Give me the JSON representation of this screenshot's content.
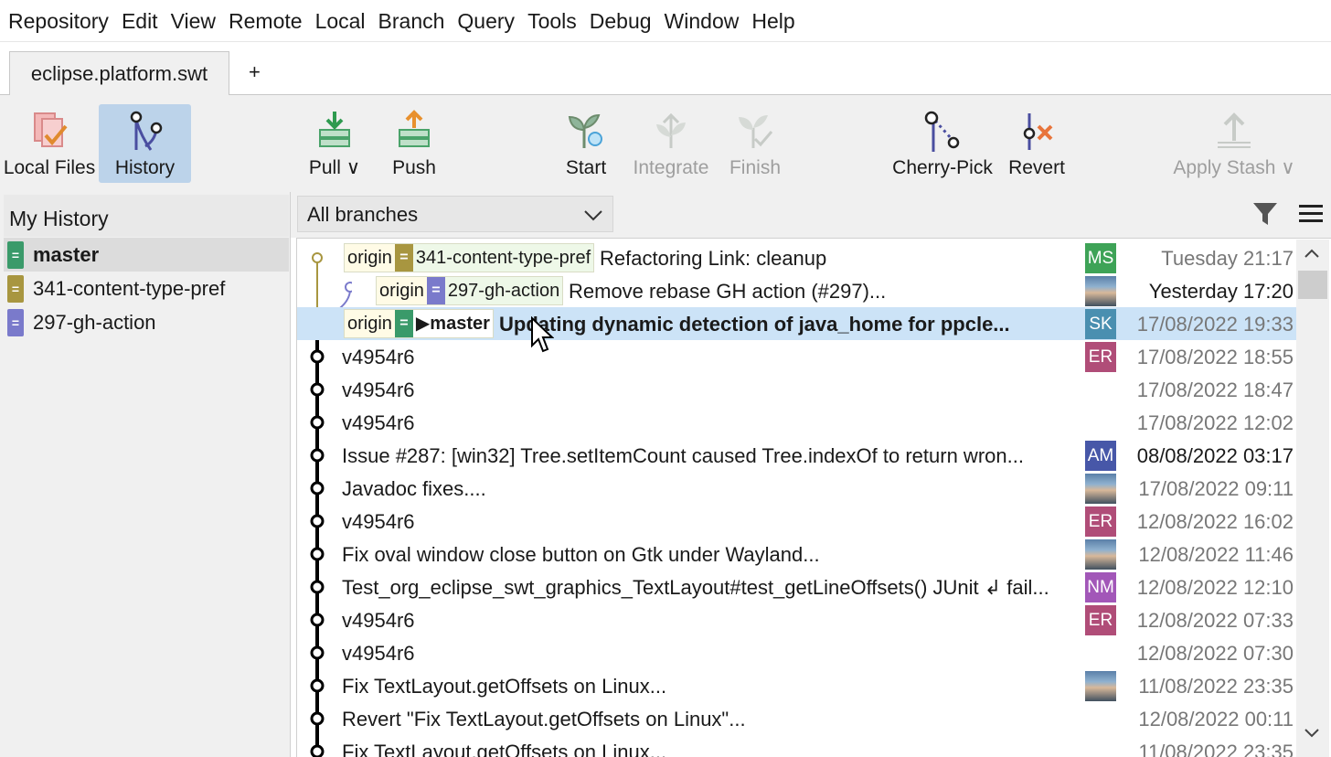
{
  "menu": [
    "Repository",
    "Edit",
    "View",
    "Remote",
    "Local",
    "Branch",
    "Query",
    "Tools",
    "Debug",
    "Window",
    "Help"
  ],
  "tabs": {
    "active": "eclipse.platform.swt",
    "add": "+"
  },
  "toolbar": {
    "local_files": "Local Files",
    "history": "History",
    "pull": "Pull ∨",
    "push": "Push",
    "start": "Start",
    "integrate": "Integrate",
    "finish": "Finish",
    "cherry_pick": "Cherry-Pick",
    "revert": "Revert",
    "apply_stash": "Apply Stash ∨"
  },
  "sidebar": {
    "title": "My History",
    "branches": [
      {
        "name": "master",
        "color": "#3a9a6a",
        "selected": true
      },
      {
        "name": "341-content-type-pref",
        "color": "#a89640"
      },
      {
        "name": "297-gh-action",
        "color": "#7a7acb"
      }
    ]
  },
  "filter": {
    "branch_select": "All branches"
  },
  "colors": {
    "graph_main": "#000000",
    "graph_olive": "#a89640",
    "graph_purple": "#7a7acb",
    "eq_green": "#3a9a6a",
    "selection": "#cce3f7"
  },
  "commits": [
    {
      "origin": "origin",
      "eq": "=",
      "branch": "341-content-type-pref",
      "eqcolor": "#a89640",
      "message": "Refactoring Link: cleanup",
      "avatar": "MS",
      "avatar_color": "#3ea357",
      "date": "Tuesday 21:17",
      "dim": true
    },
    {
      "origin": "origin",
      "eq": "=",
      "branch": "297-gh-action",
      "eqcolor": "#7a7acb",
      "message": "Remove rebase GH action (#297)...",
      "avatar": "",
      "photo": true,
      "date": "Yesterday 17:20",
      "dim": false
    },
    {
      "origin": "origin",
      "eq": "=",
      "branch": "▶master",
      "eqcolor": "#3a9a6a",
      "message": "Updating dynamic detection of java_home for ppcle...",
      "avatar": "SK",
      "avatar_color": "#4a8fb0",
      "date": "17/08/2022 19:33",
      "dim": true,
      "selected": true,
      "bold": true
    },
    {
      "message": "v4954r6",
      "avatar": "ER",
      "avatar_color": "#b04d78",
      "date": "17/08/2022 18:55",
      "dim": true
    },
    {
      "message": "v4954r6",
      "avatar": "",
      "date": "17/08/2022 18:47",
      "dim": true
    },
    {
      "message": "v4954r6",
      "avatar": "",
      "date": "17/08/2022 12:02",
      "dim": true
    },
    {
      "message": "Issue #287: [win32] Tree.setItemCount caused Tree.indexOf to return wron...",
      "avatar": "AM",
      "avatar_color": "#4757a8",
      "date": "08/08/2022 03:17",
      "dim": false
    },
    {
      "message": "Javadoc fixes....",
      "avatar": "",
      "photo": true,
      "date": "17/08/2022 09:11",
      "dim": true
    },
    {
      "message": "v4954r6",
      "avatar": "ER",
      "avatar_color": "#b04d78",
      "date": "12/08/2022 16:02",
      "dim": true
    },
    {
      "message": "Fix oval window close button on Gtk under Wayland...",
      "avatar": "",
      "photo": true,
      "date": "12/08/2022 11:46",
      "dim": true
    },
    {
      "message": "Test_org_eclipse_swt_graphics_TextLayout#test_getLineOffsets() JUnit ↲ fail...",
      "avatar": "NM",
      "avatar_color": "#a257b8",
      "date": "12/08/2022 12:10",
      "dim": true
    },
    {
      "message": "v4954r6",
      "avatar": "ER",
      "avatar_color": "#b04d78",
      "date": "12/08/2022 07:33",
      "dim": true
    },
    {
      "message": "v4954r6",
      "avatar": "",
      "date": "12/08/2022 07:30",
      "dim": true
    },
    {
      "message": "Fix TextLayout.getOffsets on Linux...",
      "avatar": "",
      "photo": true,
      "date": "11/08/2022 23:35",
      "dim": true
    },
    {
      "message": "Revert \"Fix TextLayout.getOffsets on Linux\"...",
      "avatar": "",
      "date": "12/08/2022 00:11",
      "dim": true
    },
    {
      "message": "Fix TextLayout.getOffsets on Linux...",
      "avatar": "",
      "date": "11/08/2022 23:35",
      "dim": true
    }
  ]
}
